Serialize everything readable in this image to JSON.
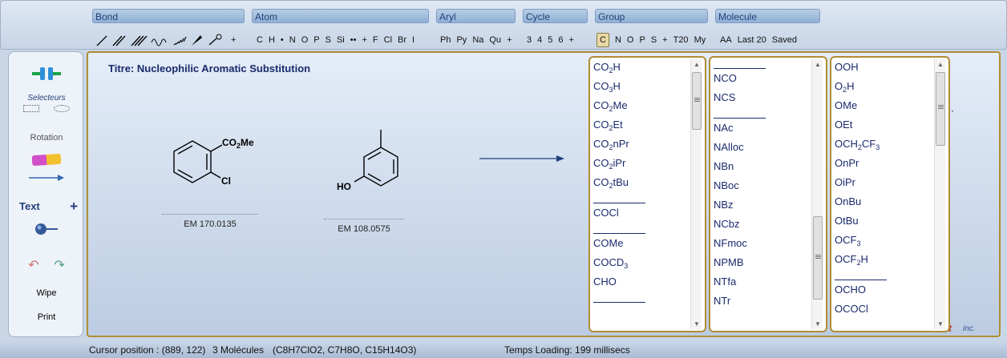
{
  "toolbar": {
    "categories": [
      "Bond",
      "Atom",
      "Aryl",
      "Cycle",
      "Group",
      "Molecule"
    ],
    "atom_items": [
      "C",
      "H",
      "•",
      "N",
      "O",
      "P",
      "S",
      "Si",
      "••",
      "+",
      "F",
      "Cl",
      "Br",
      "I"
    ],
    "aryl_items": [
      "Ph",
      "Py",
      "Na",
      "Qu",
      "+"
    ],
    "cycle_items": [
      "3",
      "4",
      "5",
      "6",
      "+"
    ],
    "group_items": [
      "C",
      "N",
      "O",
      "P",
      "S",
      "+",
      "T20",
      "My"
    ],
    "molecule_items": [
      "AA",
      "Last 20",
      "Saved"
    ],
    "bond_plus": "+"
  },
  "left_panel": {
    "selecteurs": "Selecteurs",
    "rotation": "Rotation",
    "text": "Text",
    "text_plus": "+",
    "wipe": "Wipe",
    "print": "Print"
  },
  "canvas": {
    "title": "Titre: Nucleophilic Aromatic Substitution",
    "mol1": {
      "substituent": "CO",
      "sub2": "2",
      "me": "Me",
      "cl": "Cl",
      "em": "EM 170.0135"
    },
    "mol2": {
      "oh": "HO",
      "em": "EM 108.0575"
    },
    "brand_fragment": "t",
    "brand_inc": "inc."
  },
  "lists": {
    "col1": [
      {
        "t": "CO",
        "s": "2",
        "r": "H"
      },
      {
        "t": "CO",
        "s": "3",
        "r": "H"
      },
      {
        "t": "CO",
        "s": "2",
        "r": "Me"
      },
      {
        "t": "CO",
        "s": "2",
        "r": "Et"
      },
      {
        "t": "CO",
        "s": "2",
        "r": "nPr"
      },
      {
        "t": "CO",
        "s": "2",
        "r": "iPr"
      },
      {
        "t": "CO",
        "s": "2",
        "r": "tBu"
      },
      {
        "sep": true
      },
      {
        "t": "COCl",
        "s": "",
        "r": ""
      },
      {
        "sep": true
      },
      {
        "t": "COMe",
        "s": "",
        "r": ""
      },
      {
        "t": "COCD",
        "s": "3",
        "r": ""
      },
      {
        "t": "CHO",
        "s": "",
        "r": ""
      },
      {
        "sep": true
      }
    ],
    "col2": [
      {
        "sep": true
      },
      {
        "t": "NCO",
        "s": "",
        "r": ""
      },
      {
        "t": "NCS",
        "s": "",
        "r": ""
      },
      {
        "sep": true
      },
      {
        "t": "NAc",
        "s": "",
        "r": ""
      },
      {
        "t": "NAlloc",
        "s": "",
        "r": ""
      },
      {
        "t": "NBn",
        "s": "",
        "r": ""
      },
      {
        "t": "NBoc",
        "s": "",
        "r": ""
      },
      {
        "t": "NBz",
        "s": "",
        "r": ""
      },
      {
        "t": "NCbz",
        "s": "",
        "r": ""
      },
      {
        "t": "NFmoc",
        "s": "",
        "r": ""
      },
      {
        "t": "NPMB",
        "s": "",
        "r": ""
      },
      {
        "t": "NTfa",
        "s": "",
        "r": ""
      },
      {
        "t": "NTr",
        "s": "",
        "r": ""
      }
    ],
    "col3": [
      {
        "t": "OOH",
        "s": "",
        "r": ""
      },
      {
        "t": "O",
        "s": "2",
        "r": "H"
      },
      {
        "t": "OMe",
        "s": "",
        "r": ""
      },
      {
        "t": "OEt",
        "s": "",
        "r": ""
      },
      {
        "t": "OCH",
        "s": "2",
        "r": "CF",
        "s2": "3"
      },
      {
        "t": "OnPr",
        "s": "",
        "r": ""
      },
      {
        "t": "OiPr",
        "s": "",
        "r": ""
      },
      {
        "t": "OnBu",
        "s": "",
        "r": ""
      },
      {
        "t": "OtBu",
        "s": "",
        "r": ""
      },
      {
        "t": "OCF",
        "s": "3",
        "r": ""
      },
      {
        "t": "OCF",
        "s": "2",
        "r": "H"
      },
      {
        "sep": true
      },
      {
        "t": "OCHO",
        "s": "",
        "r": ""
      },
      {
        "t": "OCOCl",
        "s": "",
        "r": ""
      }
    ]
  },
  "status": {
    "cursor": "Cursor position : (889, 122)",
    "molecules": "3 Molécules",
    "formulas": "(C8H7ClO2, C7H8O, C15H14O3)",
    "loading": "Temps Loading: 199 millisecs"
  },
  "colors": {
    "accent": "#b08d35",
    "text_blue": "#1a2a6c",
    "brand_red": "#c0392b"
  }
}
